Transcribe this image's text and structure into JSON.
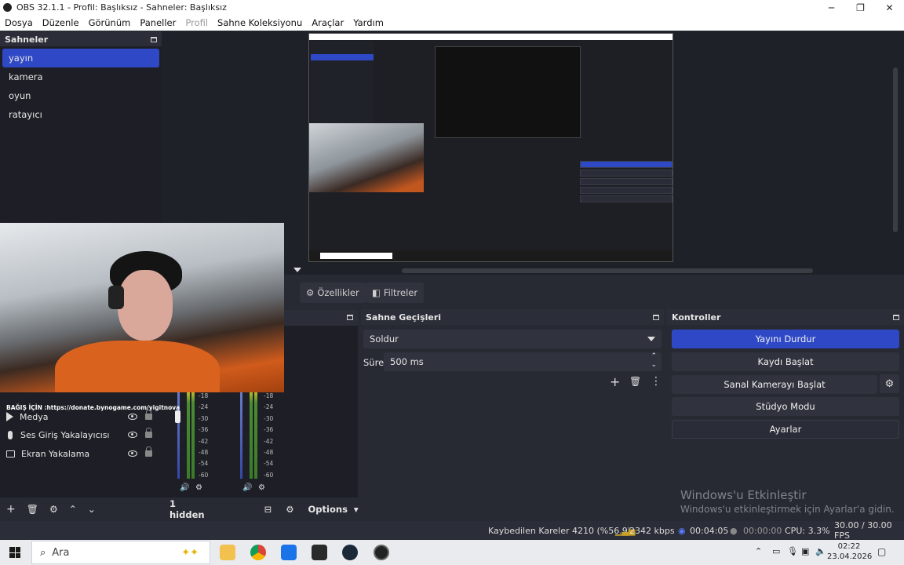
{
  "window": {
    "title": "OBS 32.1.1 - Profil: Başlıksız - Sahneler: Başlıksız",
    "minimize": "─",
    "maximize": "❐",
    "close": "✕"
  },
  "menu": [
    "Dosya",
    "Düzenle",
    "Görünüm",
    "Paneller",
    "Profil",
    "Sahne Koleksiyonu",
    "Araçlar",
    "Yardım"
  ],
  "scenes": {
    "title": "Sahneler",
    "items": [
      "yayın",
      "kamera",
      "oyun",
      "ratayıcı"
    ],
    "selected": 0
  },
  "preview_toolbar": {
    "properties": "Özellikler",
    "filters": "Filtreler"
  },
  "webcam_overlay": {
    "donate_text": "BAĞIŞ İÇİN :https://donate.bynogame.com/yigitnova"
  },
  "sources": {
    "items": [
      "Medya",
      "Ses Giriş Yakalayıcısı",
      "Ekran Yakalama"
    ]
  },
  "mixer": {
    "hidden_label": "1 hidden",
    "options_label": "Options",
    "db_ticks": [
      "-18",
      "-24",
      "-30",
      "-36",
      "-42",
      "-48",
      "-54",
      "-60"
    ]
  },
  "transitions": {
    "title": "Sahne Geçişleri",
    "current": "Soldur",
    "duration_label": "Süre",
    "duration_value": "500 ms"
  },
  "controls": {
    "title": "Kontroller",
    "stop_stream": "Yayını Durdur",
    "start_record": "Kaydı Başlat",
    "virtual_cam": "Sanal Kamerayı Başlat",
    "studio_mode": "Stüdyo Modu",
    "settings": "Ayarlar"
  },
  "activation": {
    "line1": "Windows'u Etkinleştir",
    "line2": "Windows'u etkinleştirmek için Ayarlar'a gidin."
  },
  "status": {
    "dropped": "Kaybedilen Kareler 4210 (%56.9)",
    "bitrate": "2342 kbps",
    "stream_time": "00:04:05",
    "record_time": "00:00:00",
    "cpu": "CPU: 3.3%",
    "fps": "30.00 / 30.00 FPS"
  },
  "taskbar": {
    "search_placeholder": "Ara",
    "time": "02:22",
    "date": "23.04.2026"
  },
  "colors": {
    "accent": "#2f49c6",
    "panel": "#272a33",
    "list": "#1e1f26"
  }
}
